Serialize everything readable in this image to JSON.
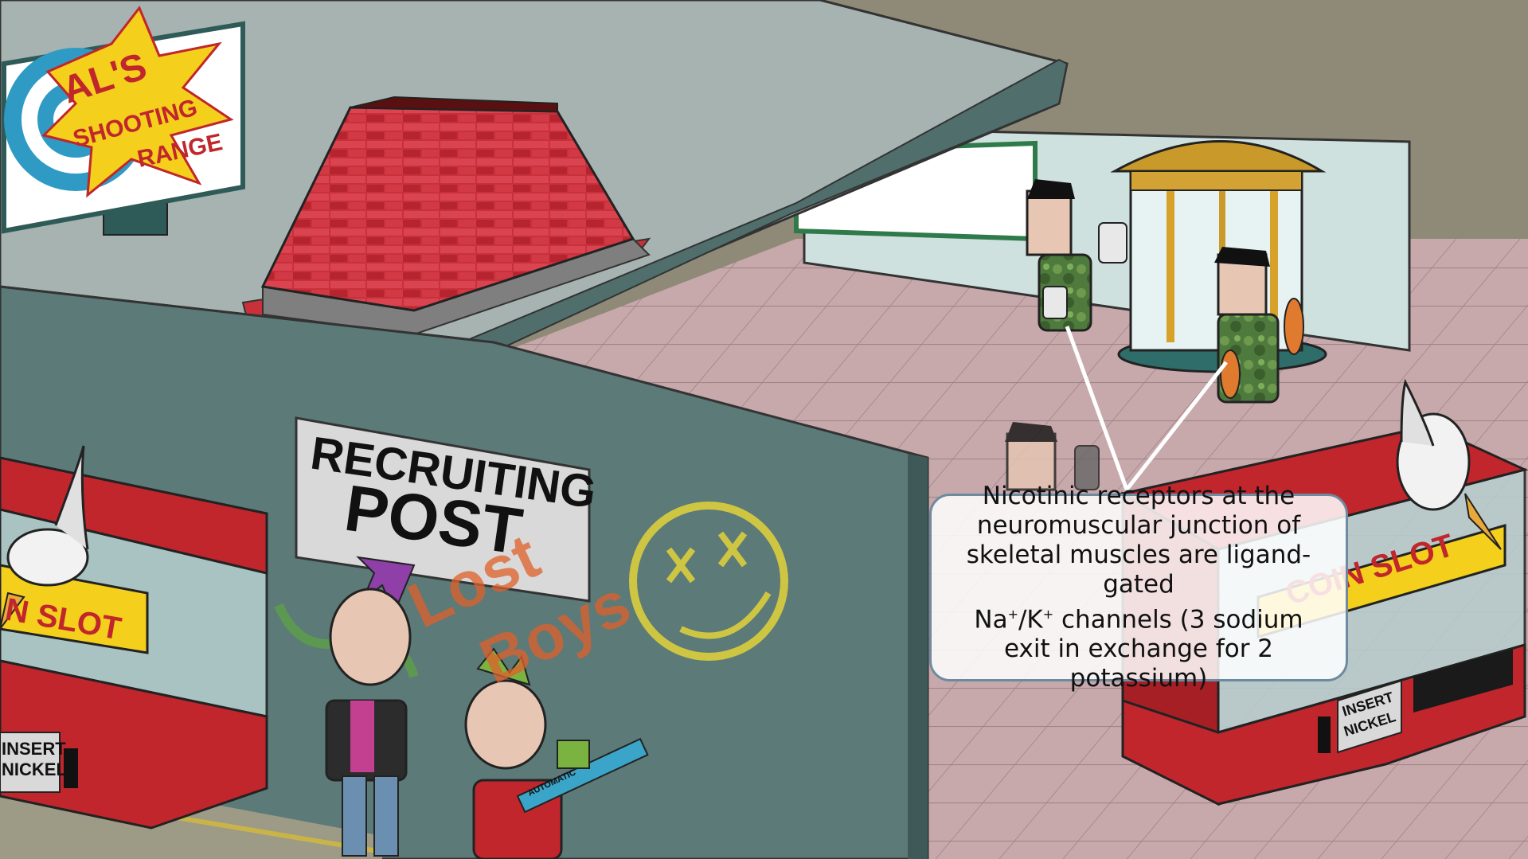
{
  "signs": {
    "shooting_range": [
      "AL'S",
      "SHOOTING",
      "RANGE"
    ],
    "recruiting_post": [
      "RECRUITING",
      "POST"
    ],
    "coin_slot_left": "N SLOT",
    "coin_slot_right": "COIN SLOT",
    "insert_nickel_left": [
      "INSERT",
      "NICKEL"
    ],
    "insert_nickel_right": [
      "INSERT",
      "NICKEL"
    ],
    "graffiti": [
      "Lost",
      "Boys"
    ],
    "gun_label": "AUTOMATIC"
  },
  "callout": {
    "line1": "Nicotinic receptors at the",
    "line2": "neuromuscular junction of",
    "line3": "skeletal muscles are ligand-gated",
    "line4_a": "Na",
    "line4_sup1": "+",
    "line4_b": "/K",
    "line4_sup2": "+",
    "line4_c": " channels (3 sodium",
    "line5": "exit in exchange for 2 potassium)"
  },
  "colors": {
    "wall": "#5b7a78",
    "roof": "#a7b3b1",
    "floor": "#c7a8ab",
    "brick": "#c9303a",
    "machine_red": "#c0262c",
    "sign_yellow": "#f4cf1b",
    "callout_border": "#6e8aa0"
  }
}
